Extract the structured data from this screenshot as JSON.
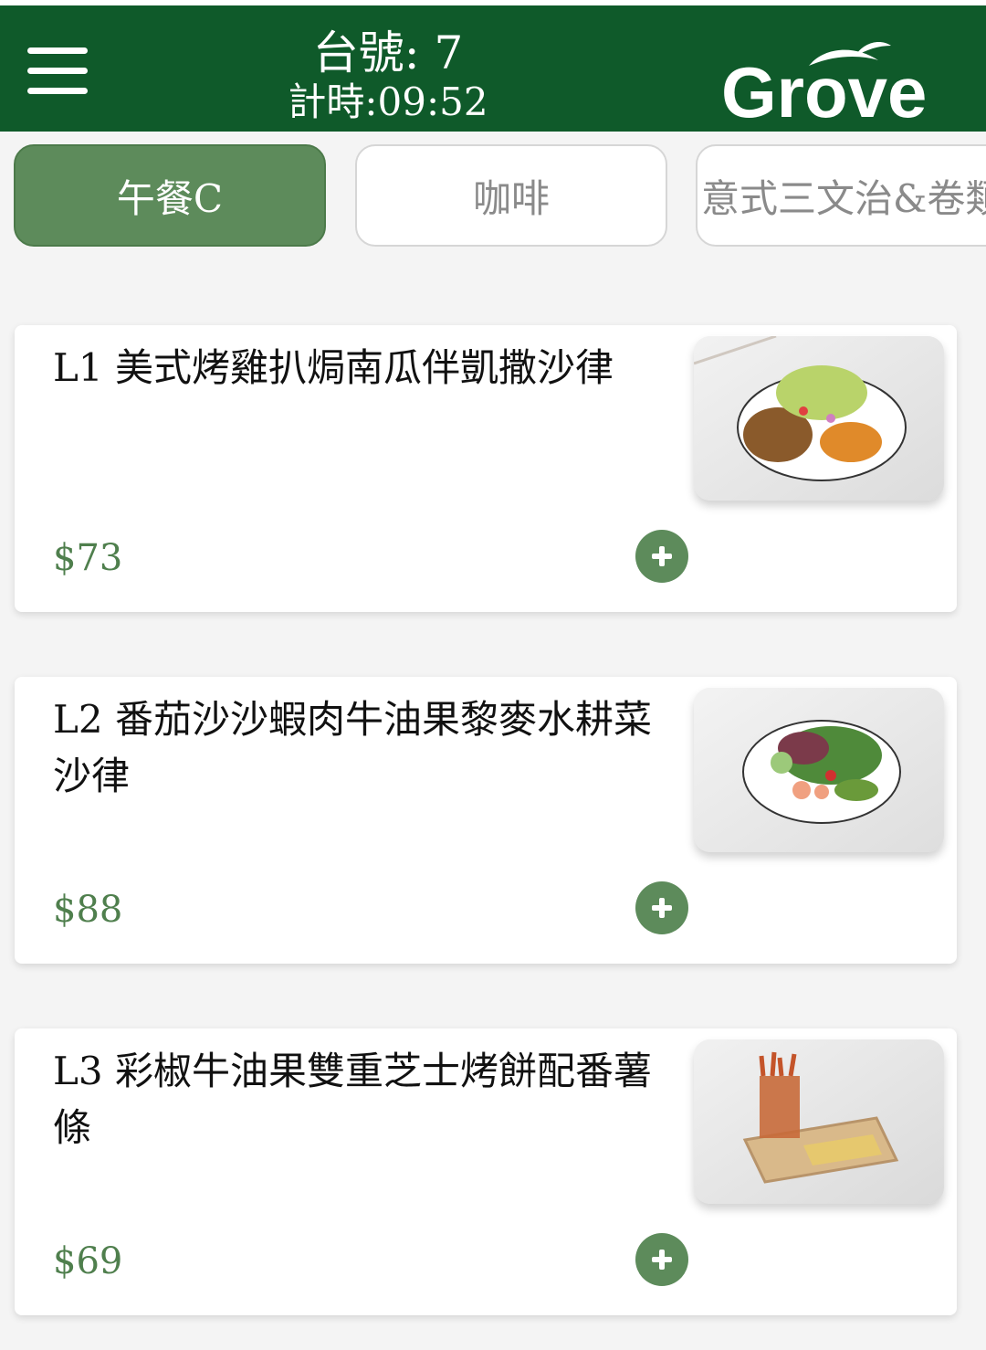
{
  "header": {
    "table_no": "台號: 7",
    "timer": "計時:09:52",
    "logo_text": "Grove",
    "bg_color": "#0f5a2a"
  },
  "tabs": [
    {
      "label": "午餐C",
      "active": true
    },
    {
      "label": "咖啡",
      "active": false
    },
    {
      "label": "意式三文治&卷類",
      "active": false
    }
  ],
  "items": [
    {
      "code_name": "L1 美式烤雞扒焗南瓜伴凱撒沙律",
      "price": "$73",
      "image": "grilled-chicken-pumpkin-salad"
    },
    {
      "code_name": "L2 番茄沙沙蝦肉牛油果黎麥水耕菜沙律",
      "price": "$88",
      "image": "shrimp-avocado-salad"
    },
    {
      "code_name": "L3 彩椒牛油果雙重芝士烤餅配番薯條",
      "price": "$69",
      "image": "quesadilla-sweet-potato-fries"
    }
  ],
  "colors": {
    "accent": "#5d8b5b",
    "price": "#4f7f4d",
    "page_bg": "#f4f4f4"
  },
  "icons": {
    "menu": "hamburger-menu-icon",
    "add": "plus-circle-icon"
  }
}
